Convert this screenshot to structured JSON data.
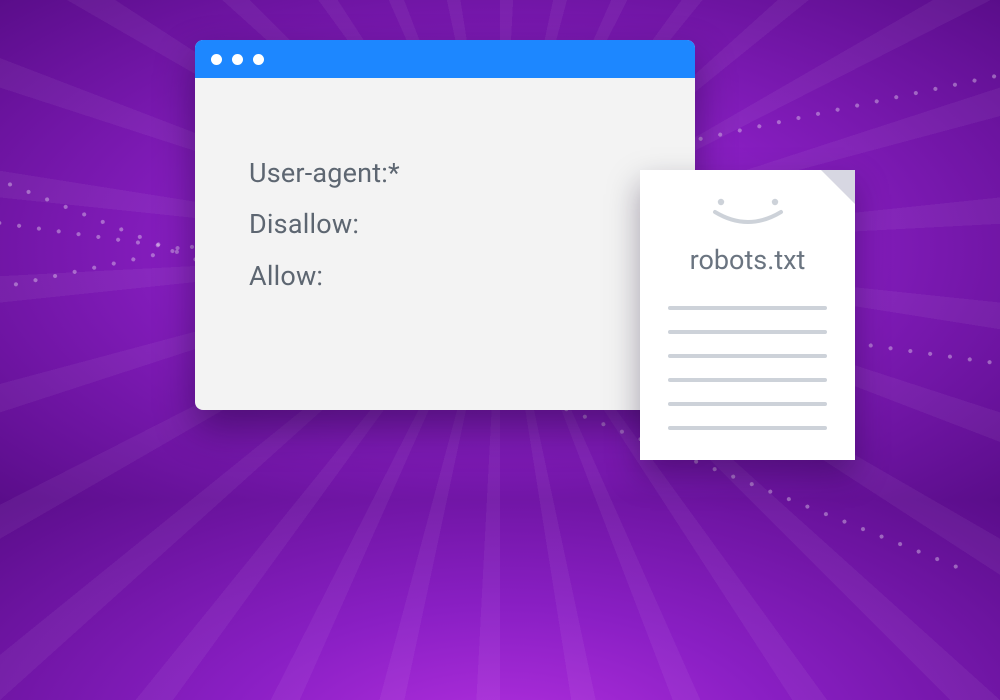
{
  "browser": {
    "lines": {
      "l1": "User-agent:*",
      "l2": "Disallow:",
      "l3": "Allow:"
    }
  },
  "file": {
    "title": "robots.txt"
  }
}
